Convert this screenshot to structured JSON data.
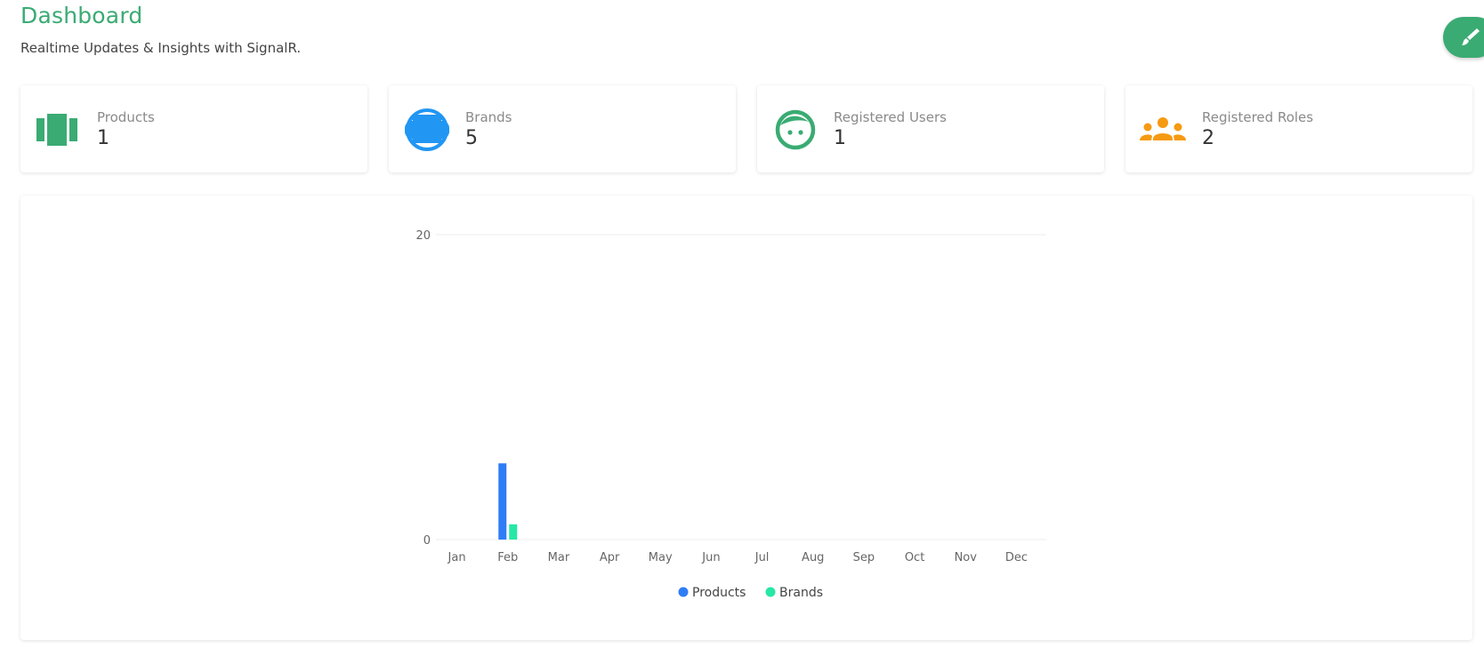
{
  "header": {
    "title": "Dashboard",
    "subtitle": "Realtime Updates & Insights with SignalR."
  },
  "fab": {
    "icon": "paintbrush-icon",
    "color": "#3aab73"
  },
  "stats": [
    {
      "label": "Products",
      "value": "1",
      "icon": "products-icon",
      "color": "#3aab73"
    },
    {
      "label": "Brands",
      "value": "5",
      "icon": "brands-icon",
      "color": "#2196f3"
    },
    {
      "label": "Registered Users",
      "value": "1",
      "icon": "user-face-icon",
      "color": "#3aab73"
    },
    {
      "label": "Registered Roles",
      "value": "2",
      "icon": "group-icon",
      "color": "#f59a12"
    }
  ],
  "chart_data": {
    "type": "bar",
    "categories": [
      "Jan",
      "Feb",
      "Mar",
      "Apr",
      "May",
      "Jun",
      "Jul",
      "Aug",
      "Sep",
      "Oct",
      "Nov",
      "Dec"
    ],
    "series": [
      {
        "name": "Products",
        "color": "#2e7cf6",
        "values": [
          0,
          5,
          0,
          0,
          0,
          0,
          0,
          0,
          0,
          0,
          0,
          0
        ]
      },
      {
        "name": "Brands",
        "color": "#26e7a6",
        "values": [
          0,
          1,
          0,
          0,
          0,
          0,
          0,
          0,
          0,
          0,
          0,
          0
        ]
      }
    ],
    "yticks": [
      "20",
      "0"
    ],
    "ylim": [
      0,
      20
    ],
    "grid": true,
    "legend": "bottom-center"
  }
}
